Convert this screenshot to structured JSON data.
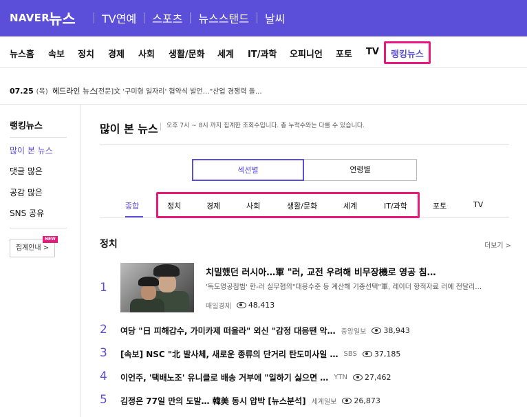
{
  "header": {
    "logo": "NAVER",
    "title": "뉴스",
    "nav": [
      "TV연예",
      "스포츠",
      "뉴스스탠드",
      "날씨"
    ]
  },
  "categories": [
    "뉴스홈",
    "속보",
    "정치",
    "경제",
    "사회",
    "생활/문화",
    "세계",
    "IT/과학",
    "오피니언",
    "포토",
    "TV",
    "랭킹뉴스"
  ],
  "ticker": {
    "date": "07.25",
    "day": "(목)",
    "label": "헤드라인 뉴스",
    "text": "[전문]文 '구미형 일자리' 협약식 발언…\"산업 경쟁력 돌…"
  },
  "sidebar": {
    "title": "랭킹뉴스",
    "items": [
      "많이 본 뉴스",
      "댓글 많은",
      "공감 많은",
      "SNS 공유"
    ],
    "guide_button": "집계안내 >",
    "new_badge": "NEW"
  },
  "main": {
    "title": "많이 본 뉴스",
    "description": "오후 7시 ~ 8시 까지 집계한 조회수입니다. 총 누적수와는 다를 수 있습니다.",
    "segments": [
      "섹션별",
      "연령별"
    ],
    "subtabs": [
      "종합",
      "정치",
      "경제",
      "사회",
      "생활/문화",
      "세계",
      "IT/과학",
      "포토",
      "TV"
    ],
    "section_title": "정치",
    "more": "더보기 >"
  },
  "articles": [
    {
      "rank": "1",
      "title": "치밀했던 러시아…軍 \"러, 교전 우려해 비무장機로 영공 침…",
      "summary": "'독도영공침범' 한-러 실무협의\"대응수준 등 계산해 기종선택\"軍, 레이더 항적자료 러에 전달리…",
      "source": "매일경제",
      "views": "48,413"
    },
    {
      "rank": "2",
      "title": "여당 \"日 피해갑수, 가미카제 떠올라\" 외신 \"감정 대응땐 악…",
      "source": "중앙일보",
      "views": "38,943"
    },
    {
      "rank": "3",
      "title": "[속보] NSC \"北 발사체, 새로운 종류의 단거리 탄도미사일 …",
      "source": "SBS",
      "views": "37,185"
    },
    {
      "rank": "4",
      "title": "이언주, '택배노조' 유니클로 배송 거부에 \"일하기 싫으면 …",
      "source": "YTN",
      "views": "27,462"
    },
    {
      "rank": "5",
      "title": "김정은 77일 만의 도발… 韓美 동시 압박 [뉴스분석]",
      "source": "세계일보",
      "views": "26,873"
    }
  ],
  "colors": {
    "brand": "#5b4fd9",
    "highlight": "#e8197d"
  }
}
